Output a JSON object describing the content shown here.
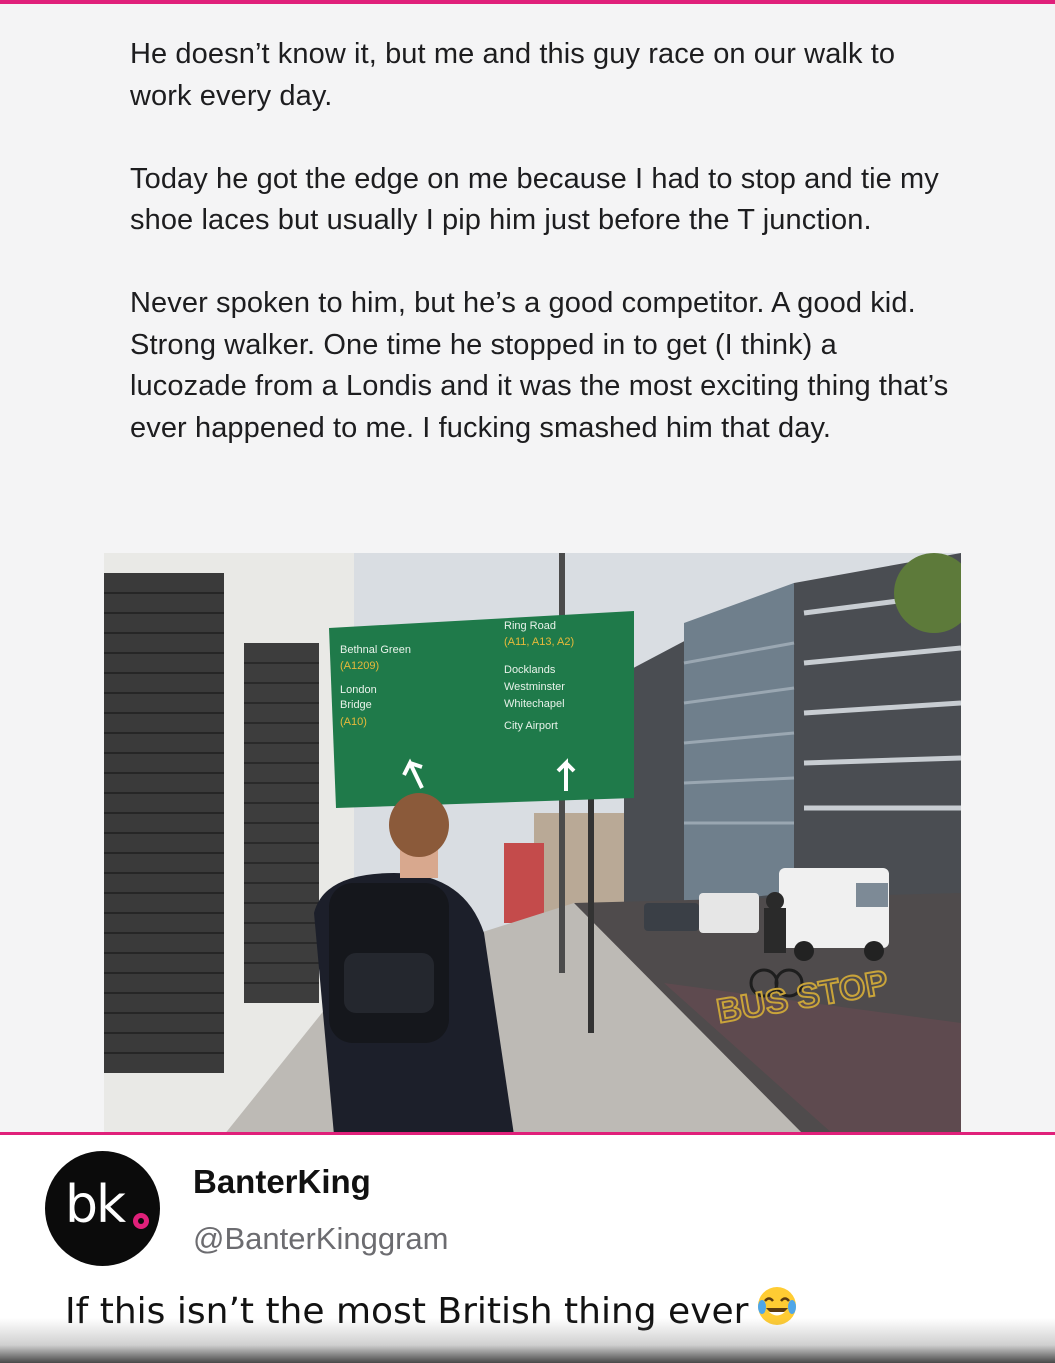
{
  "post": {
    "paragraphs": [
      "He doesn’t know it, but me and this guy race on our walk to work every day.",
      "Today he got the edge on me because I had to stop and tie my shoe laces but usually I pip him just before the T junction.",
      "Never spoken to him, but he’s a good competitor. A good kid. Strong walker. One time he stopped in to get (I think) a lucozade from a Londis and it was the most exciting thing that’s ever happened to me. I fucking smashed him that day."
    ]
  },
  "photo": {
    "sign": {
      "left_top": "Bethnal Green",
      "left_top_code": "(A1209)",
      "left_mid": "London",
      "left_mid2": "Bridge",
      "left_code": "(A10)",
      "right_top": "Ring Road",
      "right_code": "(A11, A13, A2)",
      "right_1": "Docklands",
      "right_2": "Westminster",
      "right_3": "Whitechapel",
      "right_4": "City Airport"
    },
    "road_marking": "BUS STOP"
  },
  "author": {
    "avatar_text": "bk",
    "name": "BanterKing",
    "handle": "@BanterKinggram"
  },
  "caption": {
    "text": "If this isn’t the most British thing ever",
    "emoji": "face-with-tears-of-joy-icon"
  },
  "colors": {
    "accent": "#e0207a",
    "sign_green": "#1f7a4a"
  }
}
